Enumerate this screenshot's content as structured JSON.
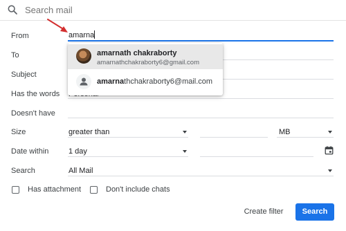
{
  "search": {
    "placeholder": "Search mail"
  },
  "fields": {
    "from": {
      "label": "From",
      "value": "amarna"
    },
    "to": {
      "label": "To"
    },
    "subject": {
      "label": "Subject"
    },
    "has_words": {
      "label": "Has the words",
      "value": "Personal"
    },
    "doesnt_have": {
      "label": "Doesn't have"
    },
    "size": {
      "label": "Size",
      "operator": "greater than",
      "unit": "MB"
    },
    "date_within": {
      "label": "Date within",
      "value": "1 day"
    },
    "search_in": {
      "label": "Search",
      "value": "All Mail"
    }
  },
  "checkboxes": {
    "has_attachment": {
      "label": "Has attachment",
      "checked": false
    },
    "dont_include_chats": {
      "label": "Don't include chats",
      "checked": false
    }
  },
  "buttons": {
    "create_filter": "Create filter",
    "search": "Search"
  },
  "suggestions": [
    {
      "name": "amarnath chakraborty",
      "email": "amarnathchakraborty6@gmail.com",
      "highlighted": true,
      "avatar": "photo"
    },
    {
      "email_match": "amarna",
      "email_rest": "thchakraborty6@mail.com",
      "highlighted": false,
      "avatar": "person-icon"
    }
  ],
  "colors": {
    "accent": "#1a73e8",
    "annotation_arrow": "#d32f2f",
    "highlight": "#e8e8e8"
  }
}
